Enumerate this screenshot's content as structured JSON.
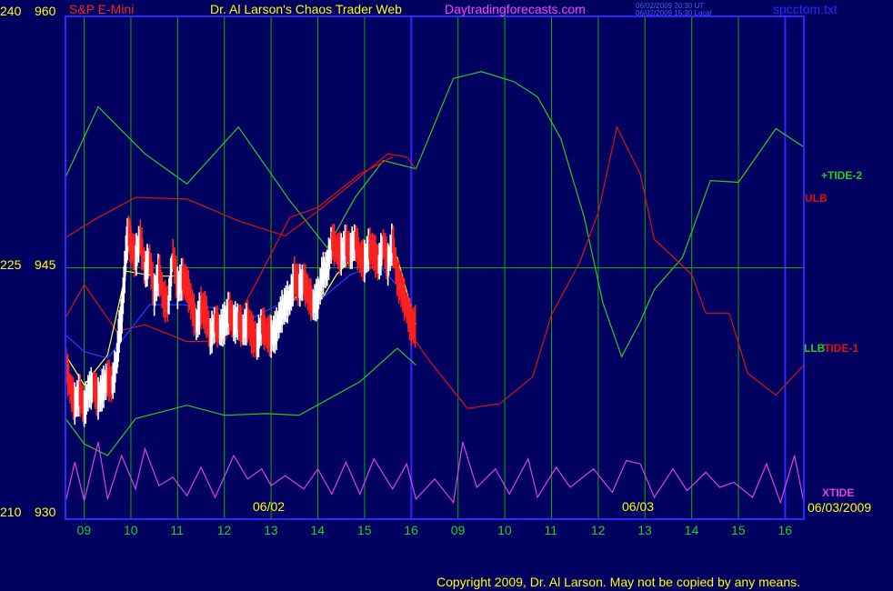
{
  "header": {
    "symbol": "S&P E-Mini",
    "title": "Dr. Al Larson's Chaos Trader Web",
    "site": "Daytradingforecasts.com",
    "time_ut": "06/02/2009 20:30 UT",
    "time_local": "06/02/2009 15:30 Local",
    "file": "spcctom.txt"
  },
  "left_axis": {
    "outer_labels": [
      "240",
      "225",
      "210"
    ],
    "inner_labels": [
      "960",
      "945",
      "930"
    ]
  },
  "x_axis": {
    "hour_labels": [
      "09",
      "10",
      "11",
      "12",
      "13",
      "14",
      "15",
      "16",
      "09",
      "10",
      "11",
      "12",
      "13",
      "14",
      "15",
      "16"
    ],
    "date_labels": [
      "06/02",
      "06/03"
    ],
    "end_date": "06/03/2009"
  },
  "legend": {
    "tide2": "+TIDE-2",
    "ulb": "ULB",
    "llb": "LLB",
    "tide1": "TIDE-1",
    "xtide": "XTIDE"
  },
  "footer": {
    "copyright": "Copyright 2009, Dr. Al Larson. May not be copied by any means."
  },
  "colors": {
    "background": "#000060",
    "frame": "#2a2aff",
    "grid": "#00b000",
    "price_up": "#ffffff",
    "price_down": "#ff2020",
    "tide2": "#20d020",
    "bands": "#e01010",
    "llb": "#20d020",
    "ma_yellow": "#ffff40",
    "ma_blue": "#2040ff",
    "xtide": "#e040e0",
    "title": "#ffff00",
    "symbol": "#ff2020",
    "site": "#ff40ff",
    "stamp": "#4060ff"
  },
  "chart_data": {
    "type": "line",
    "ylim": [
      930,
      960
    ],
    "ylim_secondary": [
      210,
      240
    ],
    "hline": 945,
    "sessions": [
      "06/02",
      "06/03"
    ],
    "series": [
      {
        "name": "+TIDE-2",
        "points": [
          [
            8.6,
            950.4
          ],
          [
            9.3,
            954.6
          ],
          [
            10.3,
            951.8
          ],
          [
            11.2,
            950.0
          ],
          [
            12.3,
            953.4
          ],
          [
            13.4,
            949.0
          ],
          [
            14.2,
            946.2
          ],
          [
            14.8,
            949.2
          ],
          [
            15.4,
            951.4
          ],
          [
            16.1,
            950.9
          ],
          [
            16.9,
            956.3
          ],
          [
            17.5,
            956.7
          ],
          [
            18.2,
            956.1
          ],
          [
            18.7,
            955.2
          ],
          [
            19.2,
            952.7
          ],
          [
            19.7,
            948.0
          ],
          [
            20.1,
            942.9
          ],
          [
            20.5,
            939.7
          ],
          [
            20.9,
            941.8
          ],
          [
            21.2,
            943.7
          ],
          [
            21.8,
            945.6
          ],
          [
            22.4,
            950.2
          ],
          [
            23.0,
            950.1
          ],
          [
            23.8,
            953.3
          ],
          [
            24.4,
            952.2
          ]
        ]
      },
      {
        "name": "ULB",
        "points": [
          [
            8.6,
            946.8
          ],
          [
            9.3,
            948.0
          ],
          [
            10.1,
            949.2
          ],
          [
            11.2,
            949.1
          ],
          [
            12.3,
            947.8
          ],
          [
            13.3,
            946.9
          ],
          [
            14.1,
            948.6
          ],
          [
            15.5,
            951.8
          ],
          [
            15.9,
            951.6
          ],
          [
            16.1,
            950.9
          ]
        ]
      },
      {
        "name": "ULB",
        "points": [
          [
            19.6,
            945.3
          ],
          [
            20.0,
            948.3
          ],
          [
            20.4,
            953.4
          ],
          [
            20.9,
            950.6
          ],
          [
            21.2,
            946.7
          ],
          [
            22.0,
            944.6
          ],
          [
            22.3,
            942.3
          ],
          [
            22.8,
            942.3
          ],
          [
            23.2,
            938.7
          ],
          [
            23.8,
            937.4
          ],
          [
            24.4,
            939.2
          ]
        ]
      },
      {
        "name": "TIDE-1",
        "points": [
          [
            8.6,
            942.0
          ],
          [
            9.0,
            944.0
          ],
          [
            9.7,
            941.2
          ],
          [
            10.3,
            941.6
          ],
          [
            11.2,
            940.6
          ],
          [
            12.0,
            940.6
          ],
          [
            12.7,
            944.2
          ],
          [
            13.4,
            948.0
          ],
          [
            14.0,
            948.6
          ],
          [
            14.9,
            950.6
          ],
          [
            15.6,
            951.6
          ]
        ]
      },
      {
        "name": "TIDE-1",
        "points": [
          [
            16.1,
            940.6
          ],
          [
            16.4,
            939.4
          ],
          [
            17.2,
            936.6
          ],
          [
            17.9,
            936.9
          ],
          [
            18.6,
            938.5
          ],
          [
            19.0,
            942.2
          ],
          [
            19.6,
            945.3
          ]
        ]
      },
      {
        "name": "LLB",
        "points": [
          [
            8.6,
            936.0
          ],
          [
            9.0,
            934.5
          ],
          [
            9.5,
            933.8
          ],
          [
            10.1,
            936.0
          ],
          [
            11.2,
            936.8
          ],
          [
            12.0,
            936.2
          ],
          [
            12.9,
            936.3
          ],
          [
            13.6,
            936.2
          ],
          [
            14.9,
            938.2
          ],
          [
            15.7,
            940.2
          ],
          [
            16.1,
            939.2
          ]
        ]
      },
      {
        "name": "MA",
        "points": [
          [
            8.6,
            939.8
          ],
          [
            9.0,
            938.0
          ],
          [
            9.5,
            939.8
          ],
          [
            9.9,
            944.8
          ],
          [
            10.5,
            944.5
          ],
          [
            11.1,
            944.5
          ],
          [
            11.5,
            941.8
          ],
          [
            12.2,
            941.6
          ],
          [
            12.6,
            941.0
          ],
          [
            13.1,
            941.2
          ],
          [
            13.6,
            943.6
          ],
          [
            14.1,
            943.2
          ],
          [
            14.4,
            944.6
          ],
          [
            15.1,
            946.6
          ],
          [
            15.7,
            945.6
          ],
          [
            16.1,
            941.6
          ]
        ]
      },
      {
        "name": "MA2",
        "points": [
          [
            8.6,
            941.0
          ],
          [
            9.0,
            940.0
          ],
          [
            9.5,
            939.6
          ],
          [
            9.9,
            941.0
          ],
          [
            10.4,
            942.8
          ],
          [
            11.1,
            942.8
          ],
          [
            11.8,
            942.6
          ],
          [
            12.6,
            942.0
          ],
          [
            13.3,
            943.0
          ],
          [
            14.1,
            943.2
          ],
          [
            14.7,
            944.6
          ],
          [
            15.3,
            945.2
          ],
          [
            15.8,
            943.6
          ],
          [
            16.1,
            942.0
          ]
        ]
      },
      {
        "name": "XTIDE",
        "points": [
          [
            8.6,
            931.0
          ],
          [
            8.8,
            933.4
          ],
          [
            9.0,
            931.1
          ],
          [
            9.3,
            934.6
          ],
          [
            9.5,
            931.2
          ],
          [
            9.8,
            933.8
          ],
          [
            10.1,
            931.8
          ],
          [
            10.3,
            934.2
          ],
          [
            10.6,
            932.0
          ],
          [
            10.9,
            932.5
          ],
          [
            11.2,
            931.4
          ],
          [
            11.5,
            933.1
          ],
          [
            11.8,
            931.3
          ],
          [
            12.2,
            933.8
          ],
          [
            12.5,
            932.4
          ],
          [
            12.8,
            933.0
          ],
          [
            13.0,
            932.0
          ],
          [
            13.3,
            932.6
          ],
          [
            13.7,
            931.8
          ],
          [
            14.0,
            933.0
          ],
          [
            14.3,
            931.5
          ],
          [
            14.6,
            933.4
          ],
          [
            14.9,
            931.5
          ],
          [
            15.2,
            933.6
          ],
          [
            15.6,
            931.8
          ],
          [
            15.9,
            933.3
          ],
          [
            16.1,
            931.2
          ],
          [
            16.5,
            932.4
          ],
          [
            16.9,
            931.0
          ],
          [
            17.1,
            934.6
          ],
          [
            17.4,
            931.9
          ],
          [
            17.8,
            933.0
          ],
          [
            18.1,
            931.5
          ],
          [
            18.5,
            933.6
          ],
          [
            18.7,
            931.3
          ],
          [
            19.1,
            933.1
          ],
          [
            19.4,
            931.9
          ],
          [
            19.9,
            933.0
          ],
          [
            20.3,
            931.6
          ],
          [
            20.6,
            933.5
          ],
          [
            20.9,
            933.3
          ],
          [
            21.2,
            931.3
          ],
          [
            21.6,
            933.0
          ],
          [
            21.9,
            931.7
          ],
          [
            22.3,
            932.8
          ],
          [
            22.6,
            931.9
          ],
          [
            22.9,
            932.2
          ],
          [
            23.3,
            931.3
          ],
          [
            23.6,
            933.3
          ],
          [
            23.9,
            931.0
          ],
          [
            24.2,
            933.8
          ],
          [
            24.4,
            931.0
          ]
        ]
      }
    ],
    "price": [
      [
        8.6,
        939.4
      ],
      [
        8.7,
        937.8
      ],
      [
        8.8,
        936.9
      ],
      [
        8.9,
        937.5
      ],
      [
        9.0,
        936.6
      ],
      [
        9.1,
        937.7
      ],
      [
        9.2,
        937.9
      ],
      [
        9.3,
        937.2
      ],
      [
        9.4,
        937.8
      ],
      [
        9.5,
        938.4
      ],
      [
        9.6,
        938.0
      ],
      [
        9.7,
        939.6
      ],
      [
        9.75,
        941.2
      ],
      [
        9.8,
        942.0
      ],
      [
        9.85,
        944.0
      ],
      [
        9.9,
        946.2
      ],
      [
        9.95,
        947.2
      ],
      [
        10.0,
        946.3
      ],
      [
        10.1,
        945.6
      ],
      [
        10.2,
        946.8
      ],
      [
        10.3,
        944.8
      ],
      [
        10.4,
        945.5
      ],
      [
        10.5,
        943.4
      ],
      [
        10.6,
        944.8
      ],
      [
        10.7,
        943.1
      ],
      [
        10.8,
        942.8
      ],
      [
        10.9,
        945.8
      ],
      [
        11.0,
        943.8
      ],
      [
        11.1,
        944.4
      ],
      [
        11.2,
        944.0
      ],
      [
        11.3,
        942.8
      ],
      [
        11.4,
        941.6
      ],
      [
        11.5,
        942.6
      ],
      [
        11.6,
        942.3
      ],
      [
        11.7,
        940.9
      ],
      [
        11.8,
        941.7
      ],
      [
        11.9,
        941.3
      ],
      [
        12.0,
        941.7
      ],
      [
        12.1,
        942.4
      ],
      [
        12.2,
        941.7
      ],
      [
        12.3,
        941.8
      ],
      [
        12.4,
        941.3
      ],
      [
        12.5,
        941.8
      ],
      [
        12.6,
        941.0
      ],
      [
        12.7,
        940.6
      ],
      [
        12.8,
        941.6
      ],
      [
        12.9,
        941.1
      ],
      [
        13.0,
        940.9
      ],
      [
        13.1,
        941.2
      ],
      [
        13.2,
        942.2
      ],
      [
        13.3,
        942.8
      ],
      [
        13.4,
        943.1
      ],
      [
        13.5,
        944.4
      ],
      [
        13.6,
        943.9
      ],
      [
        13.7,
        944.2
      ],
      [
        13.8,
        943.4
      ],
      [
        13.9,
        942.8
      ],
      [
        14.0,
        943.2
      ],
      [
        14.1,
        944.6
      ],
      [
        14.2,
        945.0
      ],
      [
        14.3,
        946.6
      ],
      [
        14.4,
        946.1
      ],
      [
        14.5,
        945.8
      ],
      [
        14.6,
        946.4
      ],
      [
        14.7,
        946.0
      ],
      [
        14.8,
        946.6
      ],
      [
        14.9,
        945.6
      ],
      [
        15.0,
        945.4
      ],
      [
        15.1,
        946.2
      ],
      [
        15.2,
        945.9
      ],
      [
        15.3,
        945.2
      ],
      [
        15.4,
        946.4
      ],
      [
        15.5,
        945.2
      ],
      [
        15.6,
        946.6
      ],
      [
        15.7,
        944.4
      ],
      [
        15.8,
        943.6
      ],
      [
        15.9,
        942.6
      ],
      [
        16.0,
        941.6
      ],
      [
        16.1,
        941.5
      ]
    ]
  }
}
